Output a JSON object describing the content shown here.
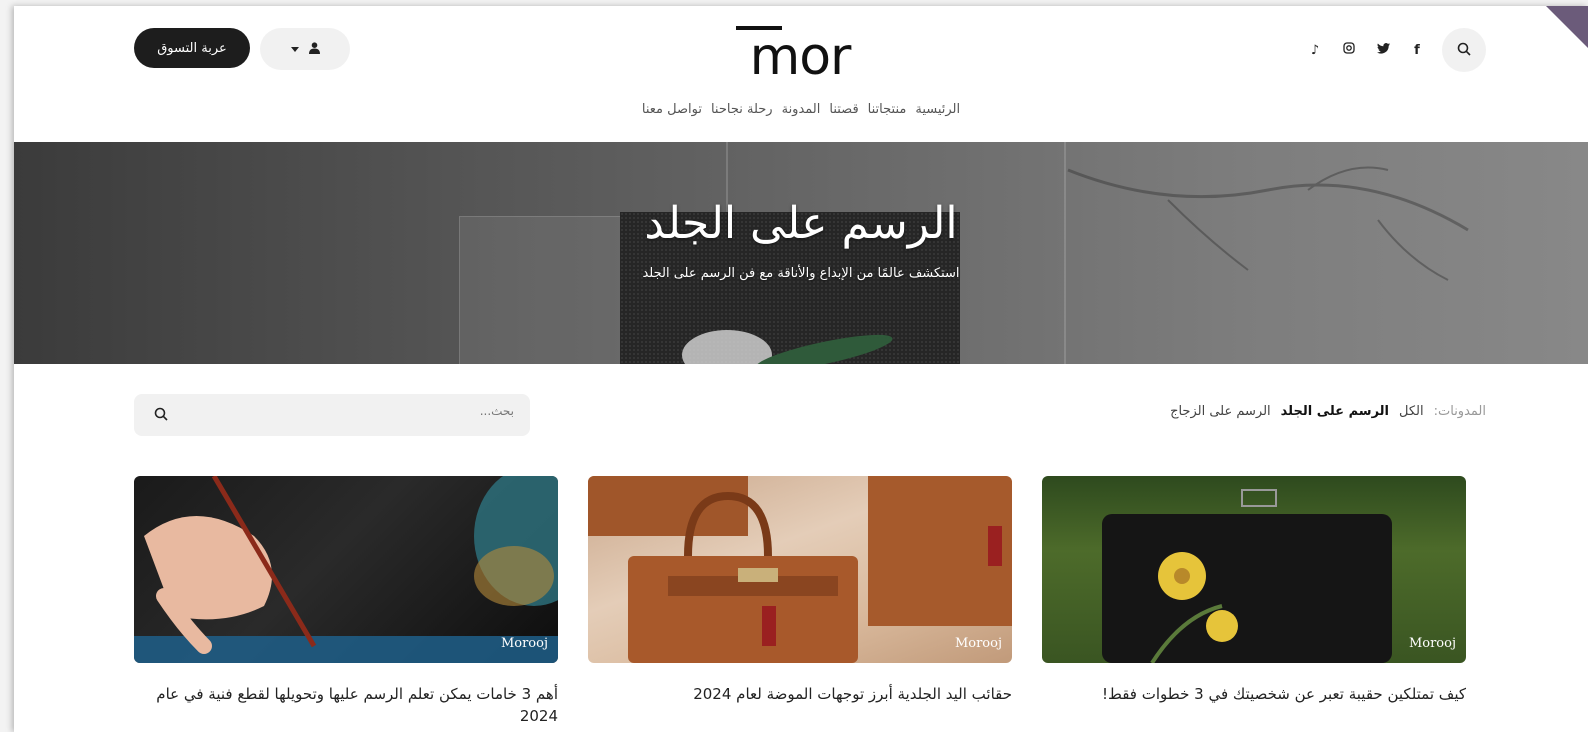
{
  "header": {
    "cart_label": "عربة التسوق",
    "logo_text": "mor"
  },
  "nav": {
    "items": [
      "الرئيسية",
      "منتجاتنا",
      "قصتنا",
      "المدونة",
      "رحلة نجاحنا",
      "تواصل معنا"
    ]
  },
  "hero": {
    "title": "الرسم على الجلد",
    "subtitle": "استكشف عالمًا من الإبداع والأناقة مع فن الرسم على الجلد"
  },
  "filters": {
    "label": "المدونات:",
    "items": [
      "الكل",
      "الرسم على الجلد",
      "الرسم على الزجاج"
    ],
    "active": "الرسم على الجلد"
  },
  "search": {
    "placeholder": "بحث..."
  },
  "cards": [
    {
      "tag": "Morooj",
      "title": "أهم 3 خامات يمكن تعلم الرسم عليها وتحويلها لقطع فنية في عام 2024"
    },
    {
      "tag": "Morooj",
      "title": "حقائب اليد الجلدية أبرز توجهات الموضة لعام 2024"
    },
    {
      "tag": "Morooj",
      "title": "كيف تمتلكين حقيبة تعبر عن شخصيتك في 3 خطوات فقط!"
    }
  ],
  "icons": {
    "search": "search-icon",
    "facebook": "facebook-icon",
    "twitter": "twitter-icon",
    "instagram": "instagram-icon",
    "tiktok": "tiktok-icon",
    "user": "user-icon",
    "caret": "caret-down-icon"
  },
  "colors": {
    "dark": "#1d1d1d",
    "light_pill": "#f1f1f1",
    "corner": "#6b5b7a"
  }
}
